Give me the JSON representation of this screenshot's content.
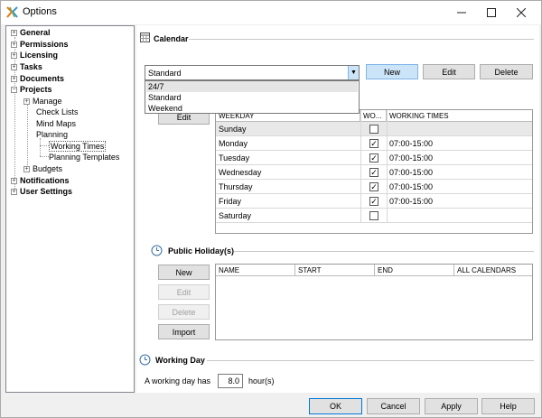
{
  "window": {
    "title": "Options"
  },
  "tree": {
    "items": [
      {
        "label": "General"
      },
      {
        "label": "Permissions"
      },
      {
        "label": "Licensing"
      },
      {
        "label": "Tasks"
      },
      {
        "label": "Documents"
      },
      {
        "label": "Projects"
      },
      {
        "label": "Manage"
      },
      {
        "label": "Check Lists"
      },
      {
        "label": "Mind Maps"
      },
      {
        "label": "Planning"
      },
      {
        "label": "Working Times"
      },
      {
        "label": "Planning Templates"
      },
      {
        "label": "Budgets"
      },
      {
        "label": "Notifications"
      },
      {
        "label": "User Settings"
      }
    ]
  },
  "calendar": {
    "heading": "Calendar",
    "selected": "Standard",
    "options": [
      "24/7",
      "Standard",
      "Weekend"
    ],
    "new_label": "New",
    "edit_label": "Edit",
    "delete_label": "Delete",
    "weekday_edit_label": "Edit"
  },
  "weekdays": {
    "headers": [
      "WEEKDAY",
      "WO...",
      "WORKING TIMES"
    ],
    "rows": [
      {
        "day": "Sunday",
        "working": false,
        "times": ""
      },
      {
        "day": "Monday",
        "working": true,
        "times": "07:00-15:00"
      },
      {
        "day": "Tuesday",
        "working": true,
        "times": "07:00-15:00"
      },
      {
        "day": "Wednesday",
        "working": true,
        "times": "07:00-15:00"
      },
      {
        "day": "Thursday",
        "working": true,
        "times": "07:00-15:00"
      },
      {
        "day": "Friday",
        "working": true,
        "times": "07:00-15:00"
      },
      {
        "day": "Saturday",
        "working": false,
        "times": ""
      }
    ]
  },
  "holidays": {
    "heading": "Public Holiday(s)",
    "new_label": "New",
    "edit_label": "Edit",
    "delete_label": "Delete",
    "import_label": "Import",
    "headers": [
      "NAME",
      "START",
      "END",
      "ALL CALENDARS"
    ]
  },
  "working_day": {
    "heading": "Working Day",
    "prefix": "A working day has",
    "hours": "8.0",
    "suffix": "hour(s)"
  },
  "footer": {
    "ok": "OK",
    "cancel": "Cancel",
    "apply": "Apply",
    "help": "Help"
  }
}
